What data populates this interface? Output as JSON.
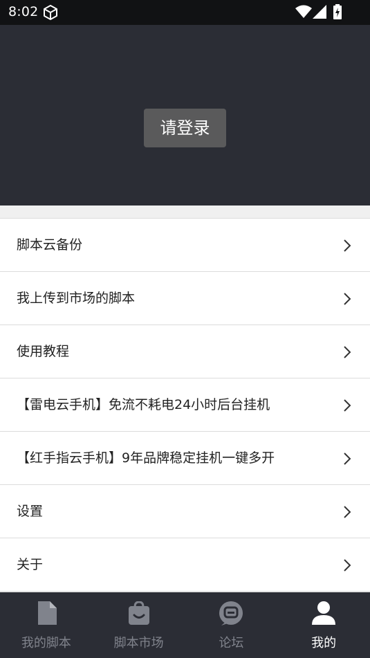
{
  "status_bar": {
    "time": "8:02"
  },
  "header": {
    "login_label": "请登录"
  },
  "menu": {
    "items": [
      {
        "label": "脚本云备份"
      },
      {
        "label": "我上传到市场的脚本"
      },
      {
        "label": "使用教程"
      },
      {
        "label": "【雷电云手机】免流不耗电24小时后台挂机"
      },
      {
        "label": "【红手指云手机】9年品牌稳定挂机一键多开"
      },
      {
        "label": "设置"
      },
      {
        "label": "关于"
      }
    ]
  },
  "tabs": [
    {
      "label": "我的脚本",
      "icon": "document-icon",
      "active": false
    },
    {
      "label": "脚本市场",
      "icon": "shopping-bag-icon",
      "active": false
    },
    {
      "label": "论坛",
      "icon": "chat-bubble-icon",
      "active": false
    },
    {
      "label": "我的",
      "icon": "person-icon",
      "active": true
    }
  ],
  "colors": {
    "header_bg": "#2b2d35",
    "status_bar_bg": "#111214",
    "login_button_bg": "#5a5a5b",
    "tab_inactive": "#80838c",
    "tab_active": "#ffffff"
  }
}
